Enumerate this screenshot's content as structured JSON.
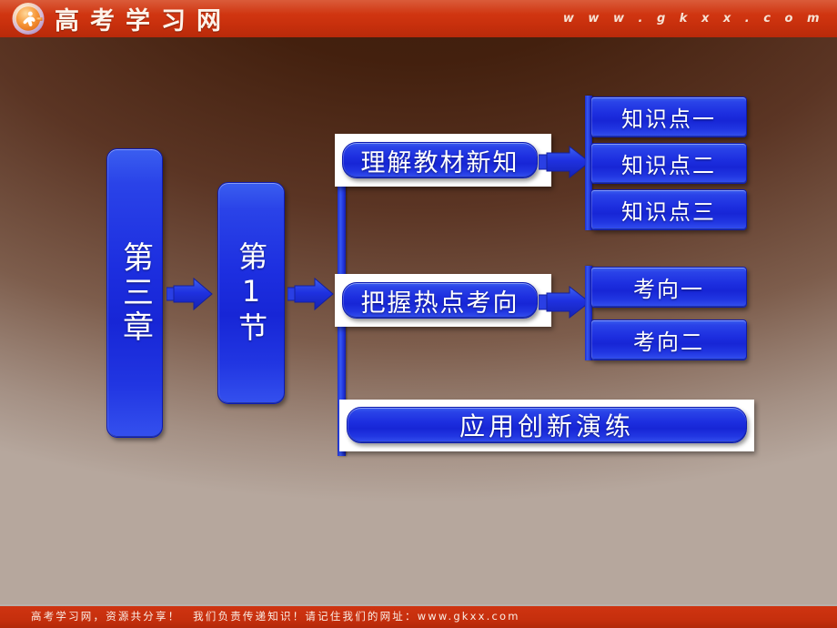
{
  "header": {
    "logo_icon": "gkxx-circle-logo",
    "brand_name": "高考学习网",
    "website": "w w w . g k x x . c o m"
  },
  "footer": {
    "text": "高考学习网，资源共分享！　我们负责传递知识！请记住我们的网址：www.gkxx.com"
  },
  "colors": {
    "header_red": "#cf3411",
    "box_blue": "#1d2fe0",
    "box_blue_light": "#3a5ef0",
    "frame_white": "#ffffff",
    "background_top": "#43200e",
    "background_bottom": "#b6a79d"
  },
  "diagram": {
    "chapter": "第三章",
    "section": "第1节",
    "branches": [
      {
        "label": "理解教材新知",
        "children": [
          "知识点一",
          "知识点二",
          "知识点三"
        ]
      },
      {
        "label": "把握热点考向",
        "children": [
          "考向一",
          "考向二"
        ]
      },
      {
        "label": "应用创新演练",
        "children": []
      }
    ]
  },
  "icons": {
    "arrow_right": "arrow-right-icon"
  }
}
